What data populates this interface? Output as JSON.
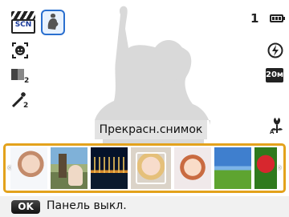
{
  "status_bar": {
    "scene_badge_text": "SCN",
    "shot_count": "1",
    "image_size": "20м"
  },
  "caption": "Прекрасн.снимок",
  "filmstrip": {
    "thumbnails": [
      {
        "icon": "portrait-woman-thumbnail"
      },
      {
        "icon": "landmark-portrait-thumbnail"
      },
      {
        "icon": "night-scene-thumbnail"
      },
      {
        "icon": "face-detect-thumbnail"
      },
      {
        "icon": "child-portrait-thumbnail"
      },
      {
        "icon": "landscape-thumbnail"
      },
      {
        "icon": "flower-macro-thumbnail"
      }
    ],
    "left_arrow": "‹",
    "right_arrow": "›"
  },
  "bottom_bar": {
    "ok_button": "OK",
    "ok_label": "Панель выкл."
  },
  "colors": {
    "accent_border": "#e3a21c",
    "scene_selected": "#2a6fcf"
  }
}
